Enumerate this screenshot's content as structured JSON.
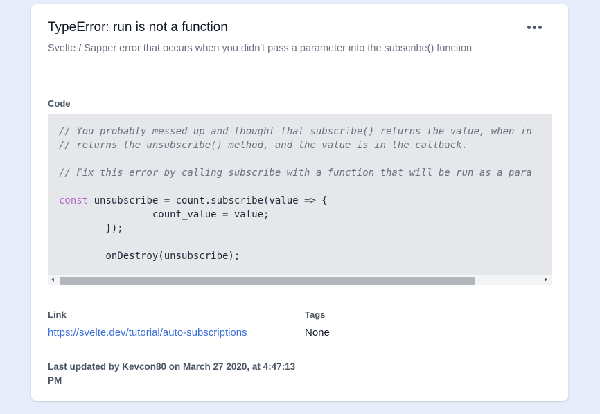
{
  "card": {
    "title": "TypeError: run is not a function",
    "description": "Svelte / Sapper error that occurs when you didn't pass a parameter into the subscribe() function",
    "menu_icon": "more-horizontal-icon"
  },
  "code_section": {
    "label": "Code",
    "lines": {
      "l1": "// You probably messed up and thought that subscribe() returns the value, when in",
      "l2": "// returns the unsubscribe() method, and the value is in the callback.",
      "l4": "// Fix this error by calling subscribe with a function that will be run as a para",
      "l6_keyword": "const",
      "l6_rest": " unsubscribe = count.subscribe(value => {",
      "l7": "                count_value = value;",
      "l8": "        });",
      "l10": "        onDestroy(unsubscribe);"
    }
  },
  "link_section": {
    "label": "Link",
    "url": "https://svelte.dev/tutorial/auto-subscriptions"
  },
  "tags_section": {
    "label": "Tags",
    "value": "None"
  },
  "footer": {
    "last_updated": "Last updated by Kevcon80 on March 27 2020, at 4:47:13 PM"
  },
  "colors": {
    "background": "#e8edfb",
    "link": "#3b6fd8",
    "keyword": "#b066c5",
    "comment": "#6b7280",
    "code_bg": "#e5e7eb"
  }
}
